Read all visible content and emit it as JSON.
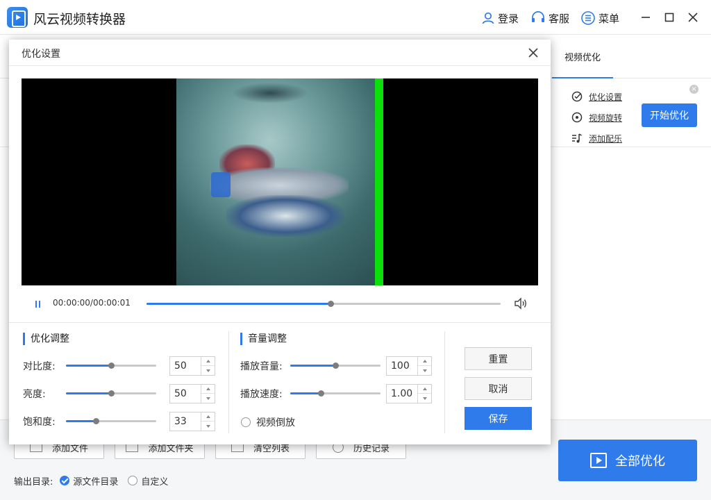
{
  "app": {
    "title": "风云视频转换器"
  },
  "titlebar": {
    "login": "登录",
    "service": "客服",
    "menu": "菜单"
  },
  "main": {
    "tab_video_opt": "视频优化",
    "file_options": [
      {
        "label": "优化设置",
        "icon": "check-settings-icon"
      },
      {
        "label": "视频旋转",
        "icon": "rotate-icon"
      },
      {
        "label": "添加配乐",
        "icon": "music-icon"
      }
    ],
    "start_button": "开始优化",
    "bottom_buttons": [
      "添加文件",
      "添加文件夹",
      "清空列表",
      "历史记录"
    ],
    "output_label": "输出目录:",
    "output_options": [
      {
        "label": "源文件目录",
        "selected": true
      },
      {
        "label": "自定义",
        "selected": false
      }
    ],
    "all_optimize_button": "全部优化"
  },
  "dialog": {
    "title": "优化设置",
    "player": {
      "time": "00:00:00/00:00:01",
      "progress_fraction": 0.52
    },
    "optimize": {
      "title": "优化调整",
      "rows": [
        {
          "label": "对比度:",
          "value": "50",
          "level": 0.5
        },
        {
          "label": "亮度:",
          "value": "50",
          "level": 0.5
        },
        {
          "label": "饱和度:",
          "value": "33",
          "level": 0.33
        }
      ]
    },
    "audio": {
      "title": "音量调整",
      "rows": [
        {
          "label": "播放音量:",
          "value": "100",
          "level": 0.5
        },
        {
          "label": "播放速度:",
          "value": "1.00",
          "level": 0.34
        }
      ],
      "reverse_label": "视频倒放",
      "reverse_checked": false
    },
    "buttons": {
      "reset": "重置",
      "cancel": "取消",
      "save": "保存"
    }
  },
  "colors": {
    "accent": "#2f7bec",
    "progress_bar": "#0be00b"
  }
}
